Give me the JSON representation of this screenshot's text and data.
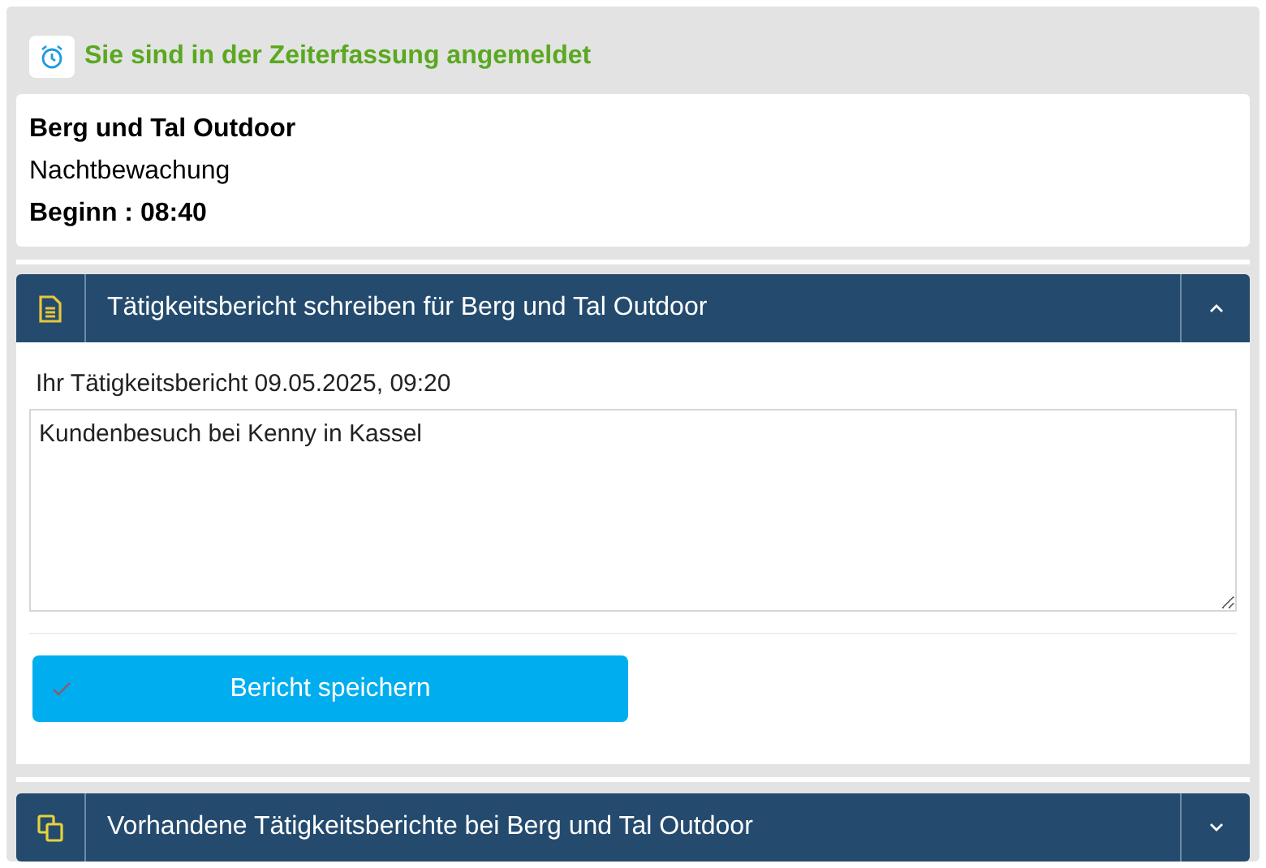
{
  "status": {
    "title": "Sie sind in der Zeiterfassung angemeldet"
  },
  "booking": {
    "company": "Berg und Tal Outdoor",
    "task": "Nachtbewachung",
    "start": "Beginn : 08:40"
  },
  "sections": [
    {
      "kind": "write",
      "title": "Tätigkeitsbericht schreiben für Berg und Tal Outdoor",
      "expanded": true,
      "report_label": "Ihr Tätigkeitsbericht 09.05.2025, 09:20",
      "report_text": "Kundenbesuch bei Kenny in Kassel",
      "save_button": "Bericht speichern"
    },
    {
      "kind": "list",
      "title": "Vorhandene Tätigkeitsberichte bei Berg und Tal Outdoor",
      "expanded": false
    }
  ]
}
